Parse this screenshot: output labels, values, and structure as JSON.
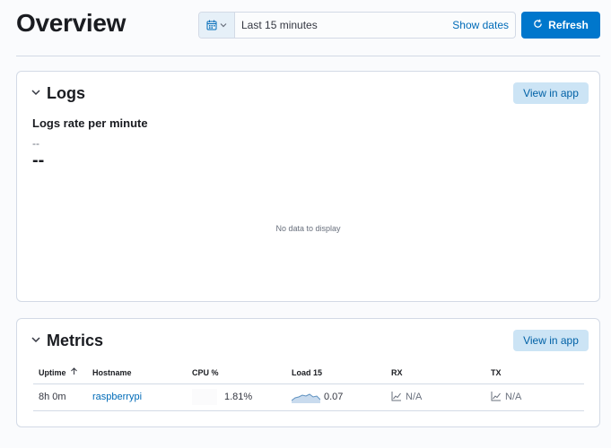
{
  "header": {
    "title": "Overview"
  },
  "date_picker": {
    "range": "Last 15 minutes",
    "show_dates": "Show dates"
  },
  "refresh": {
    "label": "Refresh"
  },
  "logs": {
    "title": "Logs",
    "view_label": "View in app",
    "subtitle": "Logs rate per minute",
    "small_value": "--",
    "big_value": "--",
    "no_data": "No data to display"
  },
  "metrics": {
    "title": "Metrics",
    "view_label": "View in app",
    "columns": [
      "Uptime",
      "Hostname",
      "CPU %",
      "Load 15",
      "RX",
      "TX"
    ],
    "rows": [
      {
        "uptime": "8h 0m",
        "hostname": "raspberrypi",
        "cpu": "1.81%",
        "load": "0.07",
        "rx": "N/A",
        "tx": "N/A"
      }
    ]
  },
  "colors": {
    "primary": "#0077cc",
    "link": "#006bb8",
    "view_btn_bg": "#cce4f5",
    "sparkline": "#6092c0"
  },
  "icons": [
    "calendar-icon",
    "chevron-down-icon",
    "refresh-icon",
    "sort-up-icon",
    "sparkline-icon",
    "chart-placeholder-icon"
  ]
}
